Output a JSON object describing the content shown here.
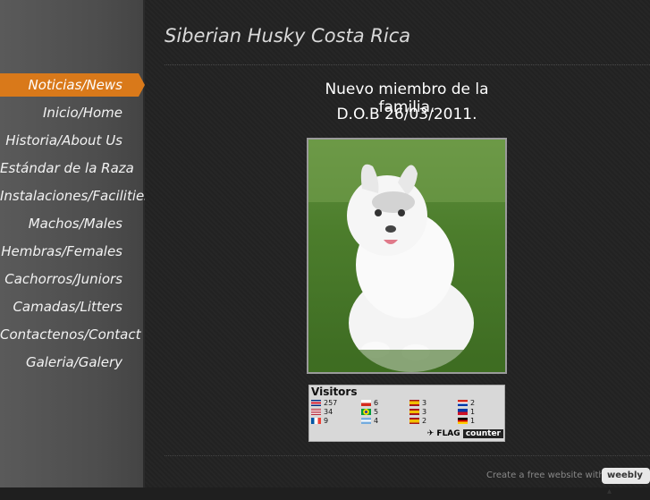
{
  "site": {
    "title": "Siberian Husky Costa Rica"
  },
  "nav": {
    "items": [
      {
        "label": "Noticias/News",
        "active": true
      },
      {
        "label": "Inicio/Home"
      },
      {
        "label": "Historia/About Us"
      },
      {
        "label": "Estándar de la Raza"
      },
      {
        "label": "Instalaciones/Facilities"
      },
      {
        "label": "Machos/Males"
      },
      {
        "label": "Hembras/Females"
      },
      {
        "label": "Cachorros/Juniors"
      },
      {
        "label": "Camadas/Litters"
      },
      {
        "label": "Contactenos/Contact"
      },
      {
        "label": "Galeria/Galery"
      }
    ]
  },
  "post": {
    "line1": "Nuevo miembro de la familia.",
    "line2": "D.O.B 26/03/2011."
  },
  "counter": {
    "title": "Visitors",
    "cells": [
      {
        "flag": "costa-rica",
        "count": "257"
      },
      {
        "flag": "united-states",
        "count": "34"
      },
      {
        "flag": "france",
        "count": "9"
      },
      {
        "flag": "chile",
        "count": "6"
      },
      {
        "flag": "brazil",
        "count": "5"
      },
      {
        "flag": "argentina",
        "count": "4"
      },
      {
        "flag": "spain",
        "count": "3"
      },
      {
        "flag": "spain",
        "count": "3"
      },
      {
        "flag": "spain",
        "count": "2"
      },
      {
        "flag": "paraguay",
        "count": "2"
      },
      {
        "flag": "philippines",
        "count": "1"
      },
      {
        "flag": "germany",
        "count": "1"
      }
    ],
    "logo_flag": "FLAG",
    "logo_counter": "counter"
  },
  "footer": {
    "text": "Create a free website with",
    "weebly_label": "weebly"
  },
  "colors": {
    "accent": "#d9791a",
    "sidebar": "#4d4d4d",
    "background": "#222222"
  }
}
